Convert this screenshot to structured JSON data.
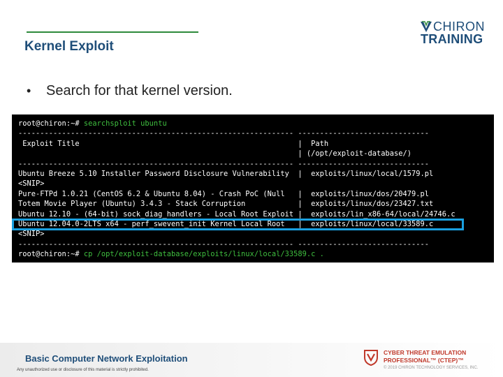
{
  "header": {
    "title": "Kernel Exploit",
    "logo_top": "CHIRON",
    "logo_bottom": "TRAINING"
  },
  "content": {
    "bullet": "Search for that kernel version."
  },
  "terminal": {
    "lines": [
      {
        "prompt": "root@chiron:~# ",
        "cmd": "searchsploit ubuntu"
      },
      {
        "text": "--------------------------------------------------------------- ------------------------------"
      },
      {
        "text": " Exploit Title                                                  |  Path"
      },
      {
        "text": "                                                                | (/opt/exploit-database/)"
      },
      {
        "text": "--------------------------------------------------------------- ------------------------------"
      },
      {
        "text": "Ubuntu Breeze 5.10 Installer Password Disclosure Vulnerability  |  exploits/linux/local/1579.pl"
      },
      {
        "text": "<SNIP>"
      },
      {
        "text": "Pure-FTPd 1.0.21 (CentOS 6.2 & Ubuntu 8.04) - Crash PoC (Null   |  exploits/linux/dos/20479.pl"
      },
      {
        "text": "Totem Movie Player (Ubuntu) 3.4.3 - Stack Corruption            |  exploits/linux/dos/23427.txt"
      },
      {
        "text": "Ubuntu 12.10 - (64-bit) sock_diag_handlers - Local Root Exploit |  exploits/lin_x86-64/local/24746.c"
      },
      {
        "text": "Ubuntu 12.04.0-2LTS x64 - perf_swevent_init Kernel Local Root   |  exploits/linux/local/33589.c"
      },
      {
        "text": "<SNIP>"
      },
      {
        "text": "--------------------------------------------------------------- ------------------------------"
      },
      {
        "prompt": "root@chiron:~# ",
        "cmd": "cp /opt/exploit-database/exploits/linux/local/33589.c ."
      }
    ]
  },
  "footer": {
    "title": "Basic Computer Network Exploitation",
    "legal": "Any unauthorized use or disclosure of this material is strictly prohibited.",
    "cert_line1": "CYBER THREAT EMULATION",
    "cert_line2": "PROFESSIONAL™ (CTEP)™",
    "copyright": "© 2019 CHIRON TECHNOLOGY SERVICES, INC."
  },
  "colors": {
    "accent": "#1f4e79",
    "rule": "#2e8a3b",
    "highlight": "#1aa0e0",
    "command": "#3fbf3f",
    "cert": "#c0392b"
  },
  "icons": [
    "chiron-logo-icon",
    "ctep-shield-icon"
  ]
}
